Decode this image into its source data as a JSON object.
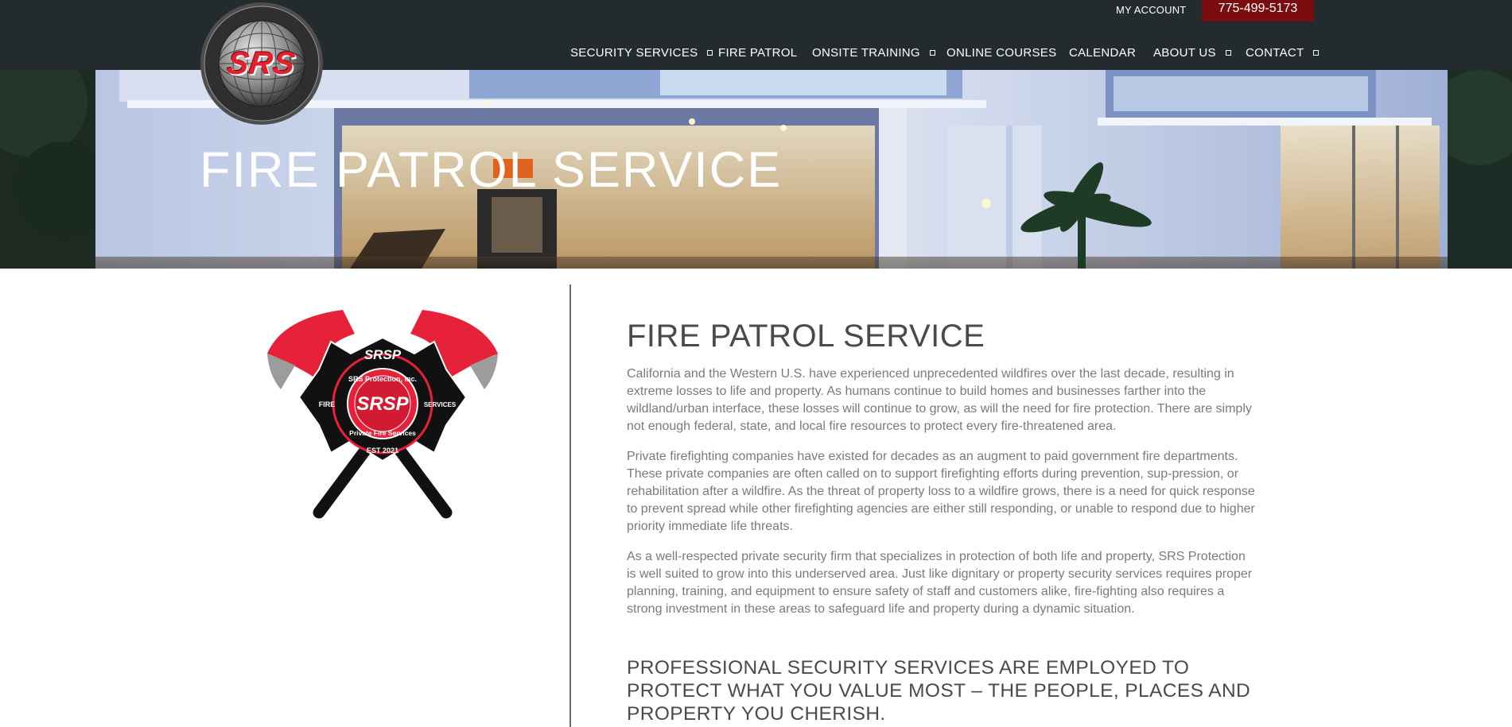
{
  "header": {
    "logo_alt": "SRS PROTECTION, INC.",
    "logo_word": "SRS",
    "my_account": "MY ACCOUNT",
    "phone": "775-499-5173",
    "nav": [
      {
        "label": "SECURITY SERVICES",
        "has_dropdown": true
      },
      {
        "label": "FIRE PATROL",
        "has_dropdown": false
      },
      {
        "label": "ONSITE TRAINING",
        "has_dropdown": true
      },
      {
        "label": "ONLINE COURSES",
        "has_dropdown": false
      },
      {
        "label": "CALENDAR",
        "has_dropdown": false
      },
      {
        "label": "ABOUT US",
        "has_dropdown": true
      },
      {
        "label": "CONTACT",
        "has_dropdown": true
      }
    ]
  },
  "hero": {
    "title": "FIRE PATROL SERVICE"
  },
  "emblem": {
    "top": "SRSP",
    "ring": "SRS Protection, Inc.",
    "bottom_ring": "Private Fire Services",
    "left": "FIRE",
    "right": "SERVICES",
    "est": "EST 2021",
    "center": "SRSP"
  },
  "main": {
    "title": "FIRE PATROL SERVICE",
    "paragraphs": [
      "California and the Western U.S. have experienced unprecedented wildfires over the last decade, resulting in extreme losses to life and property. As humans continue to build homes and businesses farther into the wildland/urban interface, these losses will continue to grow, as will the need for fire protection. There are simply not enough federal, state, and local fire resources to protect every fire-threatened area.",
      "Private firefighting companies have existed for decades as an augment to paid government fire departments. These private companies are often called on to support firefighting efforts during prevention, sup-pression, or rehabilitation after a wildfire. As the threat of property loss to a wildfire grows, there is a need for quick response to prevent spread while other firefighting agencies are either still responding, or unable to respond due to higher priority immediate life threats.",
      "As a well-respected private security firm that specializes in protection of both life and property, SRS Protection is well suited to grow into this underserved area. Just like dignitary or property security services requires proper planning, training, and equipment to ensure safety of staff and customers alike, fire-fighting also requires a strong investment in these areas to safeguard life and property during a dynamic situation."
    ],
    "subtitle": "PROFESSIONAL SECURITY SERVICES ARE EMPLOYED TO PROTECT WHAT YOU VALUE MOST – THE PEOPLE, PLACES AND PROPERTY YOU CHERISH."
  },
  "colors": {
    "header_bg": "#232b2e",
    "phone_bg": "#7a0d0d",
    "brand_red": "#e3202c",
    "heading": "#4a4a4a",
    "body_text": "#7a7a7a"
  }
}
